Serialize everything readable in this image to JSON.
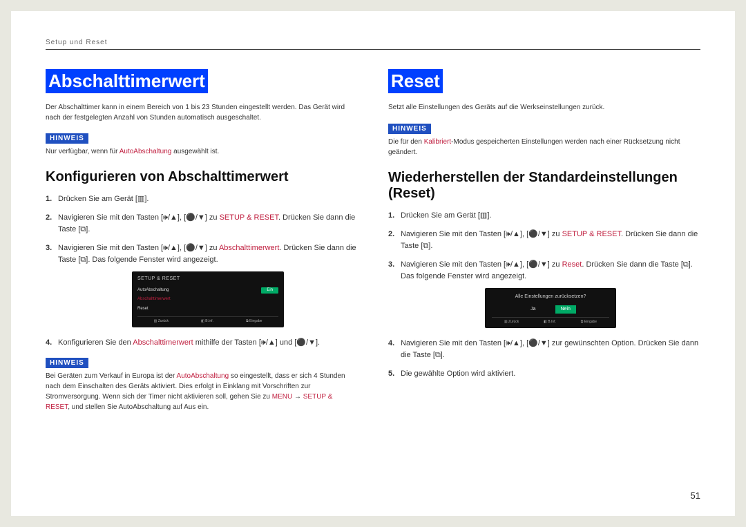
{
  "header": "Setup und Reset",
  "pageNumber": "51",
  "hinweisLabel": "HINWEIS",
  "left": {
    "title": "Abschalttimerwert",
    "desc": "Der Abschalttimer kann in einem Bereich von 1 bis 23 Stunden eingestellt werden. Das Gerät wird nach der festgelegten Anzahl von Stunden automatisch ausgeschaltet.",
    "note1a": "Nur verfügbar, wenn für ",
    "note1ref": "AutoAbschaltung",
    "note1b": " ausgewählt ist.",
    "h2": "Konfigurieren von Abschalttimerwert",
    "s1": "Drücken Sie am Gerät [▥].",
    "s2a": "Navigieren Sie mit den Tasten [🕪/▲], [⚫/▼] zu ",
    "s2ref": "SETUP & RESET",
    "s2b": ". Drücken Sie dann die Taste [⧉].",
    "s3a": "Navigieren Sie mit den Tasten [🕪/▲], [⚫/▼] zu ",
    "s3ref": "Abschalttimerwert",
    "s3b": ". Drücken Sie dann die Taste [⧉]. Das folgende Fenster wird angezeigt.",
    "s4a": "Konfigurieren Sie den ",
    "s4ref": "Abschalttimerwert",
    "s4b": " mithilfe der Tasten [🕪/▲] und [⚫/▼].",
    "note2a": "Bei Geräten zum Verkauf in Europa ist der ",
    "note2ref1": "AutoAbschaltung",
    "note2b": " so eingestellt, dass er sich 4 Stunden nach dem Einschalten des Geräts aktiviert. Dies erfolgt in Einklang mit Vorschriften zur Stromversorgung. Wenn sich der Timer nicht aktivieren soll, gehen Sie zu ",
    "note2ref2": "MENU",
    "note2arrow": " → ",
    "note2ref3": "SETUP & RESET",
    "note2c": ", und stellen Sie AutoAbschaltung auf Aus ein.",
    "osd": {
      "title": "SETUP & RESET",
      "rows": [
        {
          "k": "AutoAbschaltung",
          "v": "Ein"
        },
        {
          "k": "Abschalttimerwert",
          "v": " "
        },
        {
          "k": "Reset",
          "v": ""
        }
      ],
      "foot": [
        "▥ Zurück",
        "◧ B.Inf.",
        "⧉ Eingabe"
      ]
    }
  },
  "right": {
    "title": "Reset",
    "desc": "Setzt alle Einstellungen des Geräts auf die Werkseinstellungen zurück.",
    "note1a": "Die für den ",
    "note1ref": "Kalibriert",
    "note1b": "-Modus gespeicherten Einstellungen werden nach einer Rücksetzung nicht geändert.",
    "h2": "Wiederherstellen der Standardeinstellungen (Reset)",
    "s1": "Drücken Sie am Gerät [▥].",
    "s2a": "Navigieren Sie mit den Tasten [🕪/▲], [⚫/▼] zu ",
    "s2ref": "SETUP & RESET",
    "s2b": ". Drücken Sie dann die Taste [⧉].",
    "s3a": "Navigieren Sie mit den Tasten [🕪/▲], [⚫/▼] zu ",
    "s3ref": "Reset",
    "s3b": ". Drücken Sie dann die Taste [⧉]. Das folgende Fenster wird angezeigt.",
    "s4": "Navigieren Sie mit den Tasten [🕪/▲], [⚫/▼] zur gewünschten Option. Drücken Sie dann die Taste [⧉].",
    "s5": "Die gewählte Option wird aktiviert.",
    "osd": {
      "q": "Alle Einstellungen zurücksetzen?",
      "opts": [
        "Ja",
        "Nein"
      ],
      "foot": [
        "▥ Zurück",
        "◧ B.Inf.",
        "⧉ Eingabe"
      ]
    }
  }
}
